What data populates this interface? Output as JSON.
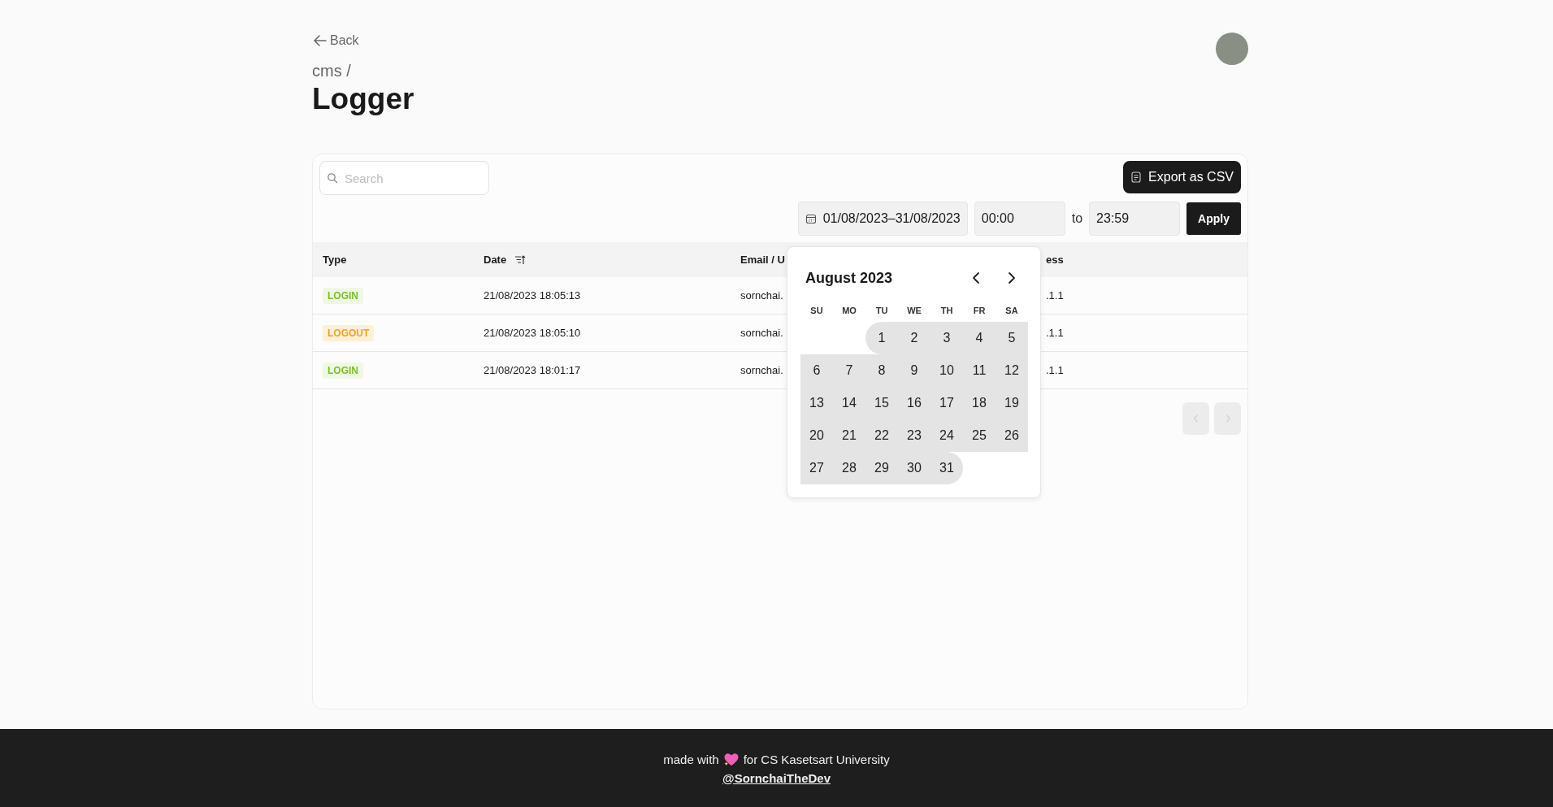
{
  "back": {
    "label": "Back"
  },
  "breadcrumb": "cms /",
  "title": "Logger",
  "search": {
    "placeholder": "Search"
  },
  "export_button": "Export as CSV",
  "filter": {
    "date_range": "01/08/2023–31/08/2023",
    "time_from": "00:00",
    "separator": "to",
    "time_to": "23:59",
    "apply": "Apply"
  },
  "table": {
    "columns": [
      "Type",
      "Date",
      "Email / U",
      "ess"
    ],
    "rows": [
      {
        "type": "LOGIN",
        "kind": "login",
        "date": "21/08/2023 18:05:13",
        "email": "sornchai.",
        "ip": ".1.1"
      },
      {
        "type": "LOGOUT",
        "kind": "logout",
        "date": "21/08/2023 18:05:10",
        "email": "sornchai.",
        "ip": ".1.1"
      },
      {
        "type": "LOGIN",
        "kind": "login",
        "date": "21/08/2023 18:01:17",
        "email": "sornchai.",
        "ip": ".1.1"
      }
    ]
  },
  "pagination": {
    "prev_disabled": true,
    "next_disabled": true
  },
  "calendar": {
    "month": "August 2023",
    "weekdays": [
      "SU",
      "MO",
      "TU",
      "WE",
      "TH",
      "FR",
      "SA"
    ],
    "weeks": [
      [
        {
          "in_range": false
        },
        {
          "in_range": false
        },
        {
          "day": "1",
          "in_range": true
        },
        {
          "day": "2",
          "in_range": true
        },
        {
          "day": "3",
          "in_range": true
        },
        {
          "day": "4",
          "in_range": true
        },
        {
          "day": "5",
          "in_range": true
        }
      ],
      [
        {
          "day": "6",
          "in_range": true
        },
        {
          "day": "7",
          "in_range": true
        },
        {
          "day": "8",
          "in_range": true
        },
        {
          "day": "9",
          "in_range": true
        },
        {
          "day": "10",
          "in_range": true
        },
        {
          "day": "11",
          "in_range": true
        },
        {
          "day": "12",
          "in_range": true
        }
      ],
      [
        {
          "day": "13",
          "in_range": true
        },
        {
          "day": "14",
          "in_range": true
        },
        {
          "day": "15",
          "in_range": true
        },
        {
          "day": "16",
          "in_range": true
        },
        {
          "day": "17",
          "in_range": true
        },
        {
          "day": "18",
          "in_range": true
        },
        {
          "day": "19",
          "in_range": true
        }
      ],
      [
        {
          "day": "20",
          "in_range": true
        },
        {
          "day": "21",
          "in_range": true
        },
        {
          "day": "22",
          "in_range": true
        },
        {
          "day": "23",
          "in_range": true
        },
        {
          "day": "24",
          "in_range": true
        },
        {
          "day": "25",
          "in_range": true
        },
        {
          "day": "26",
          "in_range": true
        }
      ],
      [
        {
          "day": "27",
          "in_range": true
        },
        {
          "day": "28",
          "in_range": true
        },
        {
          "day": "29",
          "in_range": true
        },
        {
          "day": "30",
          "in_range": true
        },
        {
          "day": "31",
          "in_range": true
        },
        {
          "in_range": false
        },
        {
          "in_range": false
        }
      ]
    ]
  },
  "footer": {
    "before": "made with",
    "after": "for CS Kasetsart University",
    "link": "@SornchaiTheDev"
  }
}
